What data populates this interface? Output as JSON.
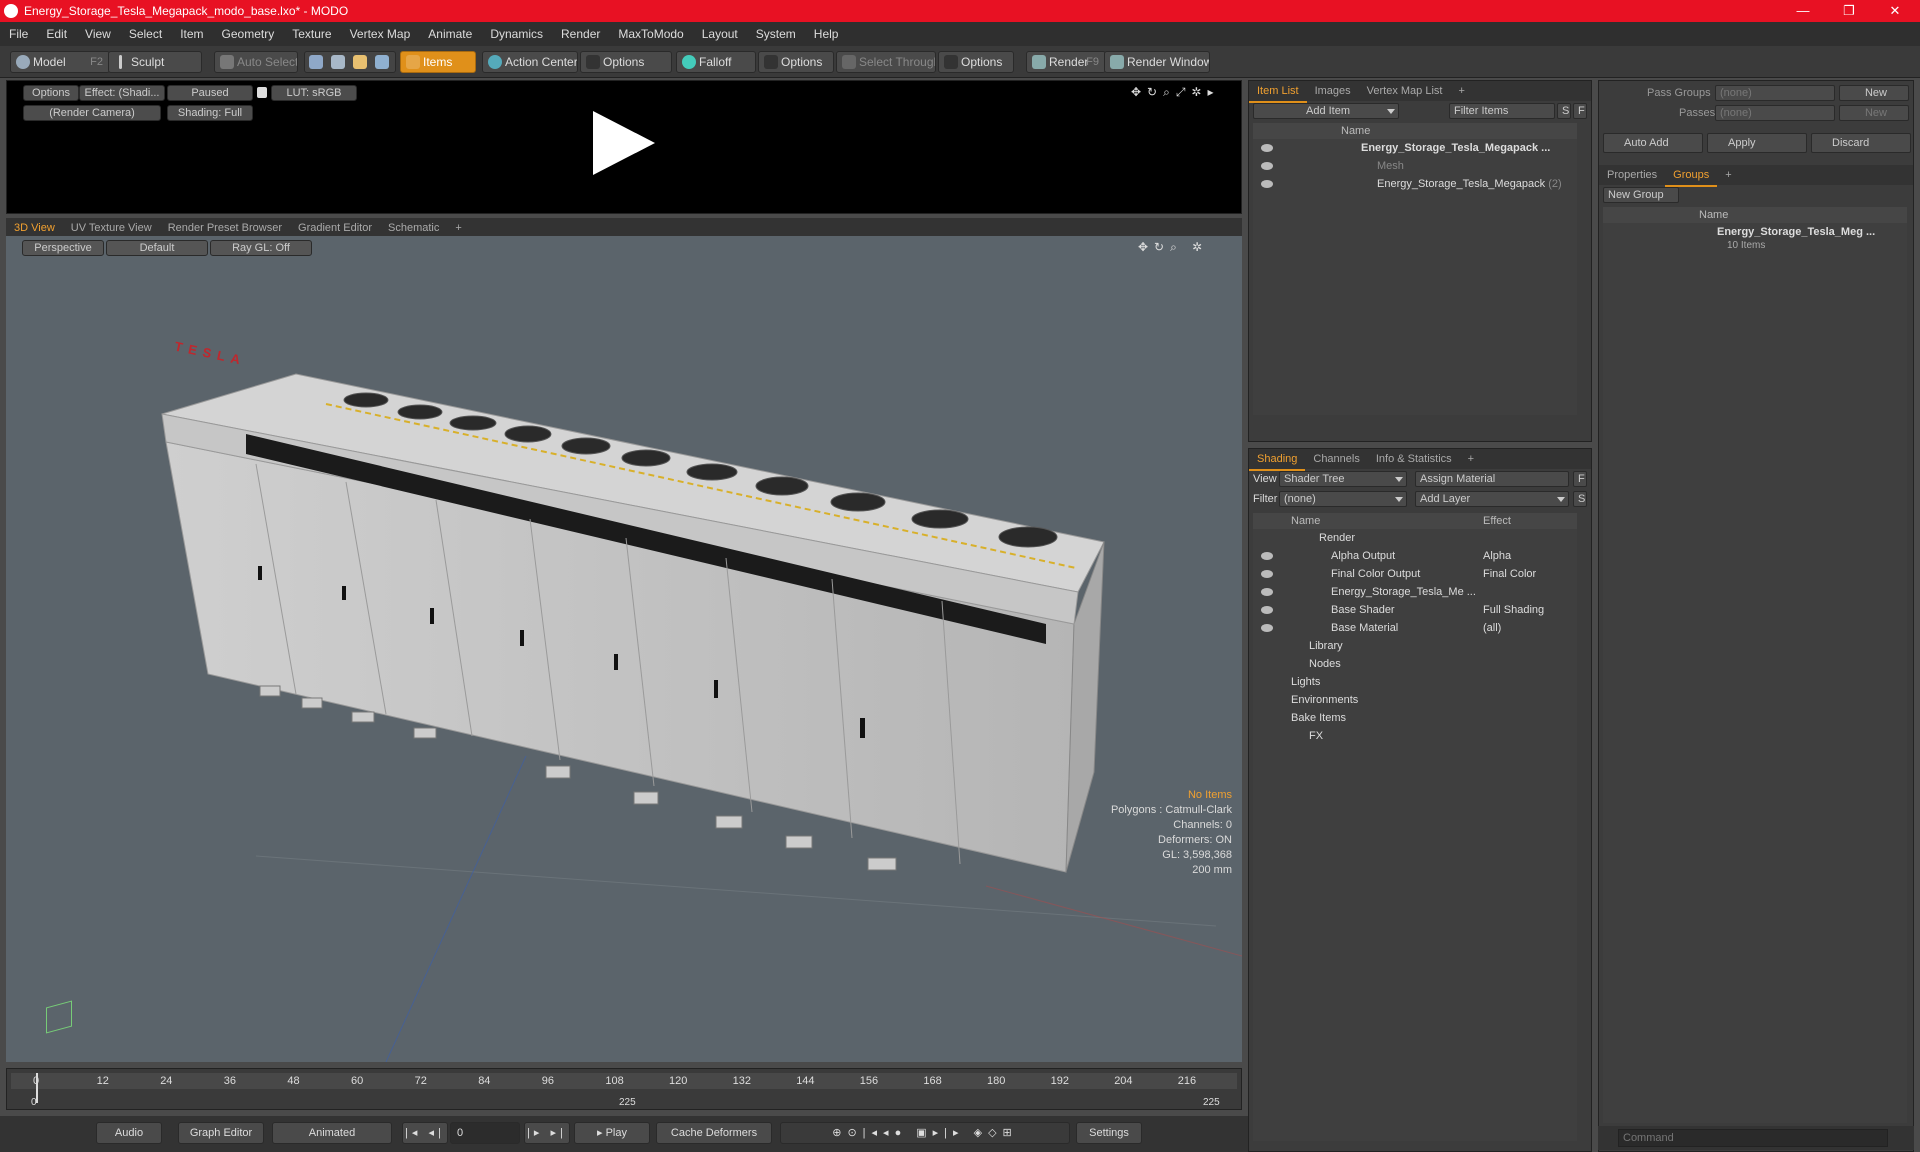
{
  "window": {
    "title": "Energy_Storage_Tesla_Megapack_modo_base.lxo* - MODO",
    "min": "—",
    "max": "❐",
    "close": "✕"
  },
  "menu": [
    "File",
    "Edit",
    "View",
    "Select",
    "Item",
    "Geometry",
    "Texture",
    "Vertex Map",
    "Animate",
    "Dynamics",
    "Render",
    "MaxToModo",
    "Layout",
    "System",
    "Help"
  ],
  "toolbar": {
    "model": "Model",
    "model_key": "F2",
    "sculpt": "Sculpt",
    "auto_select": "Auto Select",
    "items": "Items",
    "action_center": "Action Center",
    "options1": "Options",
    "falloff": "Falloff",
    "options2": "Options",
    "select_through": "Select Through",
    "options3": "Options",
    "render": "Render",
    "render_key": "F9",
    "render_window": "Render Window"
  },
  "preview": {
    "options": "Options",
    "effect": "Effect: (Shadi...",
    "paused": "Paused",
    "lut": "LUT: sRGB",
    "camera": "(Render Camera)",
    "shading": "Shading: Full"
  },
  "view_tabs": [
    "3D View",
    "UV Texture View",
    "Render Preset Browser",
    "Gradient Editor",
    "Schematic",
    "+"
  ],
  "viewport": {
    "projection": "Perspective",
    "style": "Default",
    "raygl": "Ray GL: Off",
    "hud": {
      "no_items": "No Items",
      "polygons": "Polygons : Catmull-Clark",
      "channels": "Channels: 0",
      "deformers": "Deformers: ON",
      "gl": "GL: 3,598,368",
      "scale": "200 mm"
    },
    "model_label": "TESLA"
  },
  "timeline": {
    "ticks": [
      "0",
      "12",
      "24",
      "36",
      "48",
      "60",
      "72",
      "84",
      "96",
      "108",
      "120",
      "132",
      "144",
      "156",
      "168",
      "180",
      "192",
      "204",
      "216"
    ],
    "start": "0",
    "mid": "225",
    "end": "225"
  },
  "bottom": {
    "audio": "Audio",
    "graph_editor": "Graph Editor",
    "animated": "Animated",
    "frame": "0",
    "play": "Play",
    "cache": "Cache Deformers",
    "settings": "Settings"
  },
  "item_list": {
    "tabs": [
      "Item List",
      "Images",
      "Vertex Map List",
      "+"
    ],
    "add_item": "Add Item",
    "filter": "Filter Items",
    "s": "S",
    "f": "F",
    "col_name": "Name",
    "rows": [
      {
        "label": "Energy_Storage_Tesla_Megapack ...",
        "bold": true
      },
      {
        "label": "Mesh",
        "dim": true
      },
      {
        "label": "Energy_Storage_Tesla_Megapack",
        "count": "(2)"
      }
    ]
  },
  "shading": {
    "tabs": [
      "Shading",
      "Channels",
      "Info & Statistics",
      "+"
    ],
    "view_label": "View",
    "view_value": "Shader Tree",
    "assign": "Assign Material",
    "filter_label": "Filter",
    "filter_value": "(none)",
    "add_layer": "Add Layer",
    "f": "F",
    "s": "S",
    "col_name": "Name",
    "col_effect": "Effect",
    "rows": [
      {
        "name": "Render",
        "effect": ""
      },
      {
        "name": "Alpha Output",
        "effect": "Alpha"
      },
      {
        "name": "Final Color Output",
        "effect": "Final Color"
      },
      {
        "name": "Energy_Storage_Tesla_Me ...",
        "effect": ""
      },
      {
        "name": "Base Shader",
        "effect": "Full Shading"
      },
      {
        "name": "Base Material",
        "effect": "(all)"
      },
      {
        "name": "Library",
        "effect": ""
      },
      {
        "name": "Nodes",
        "effect": ""
      },
      {
        "name": "Lights",
        "effect": ""
      },
      {
        "name": "Environments",
        "effect": ""
      },
      {
        "name": "Bake Items",
        "effect": ""
      },
      {
        "name": "FX",
        "effect": ""
      }
    ]
  },
  "groups": {
    "pass_groups": "Pass Groups",
    "passes": "Passes",
    "none": "(none)",
    "new": "New",
    "auto_add": "Auto Add",
    "apply": "Apply",
    "discard": "Discard",
    "tabs": [
      "Properties",
      "Groups",
      "+"
    ],
    "new_group": "New Group",
    "col_name": "Name",
    "item_name": "Energy_Storage_Tesla_Meg ...",
    "item_count": "10 Items"
  },
  "command": {
    "placeholder": "Command"
  }
}
